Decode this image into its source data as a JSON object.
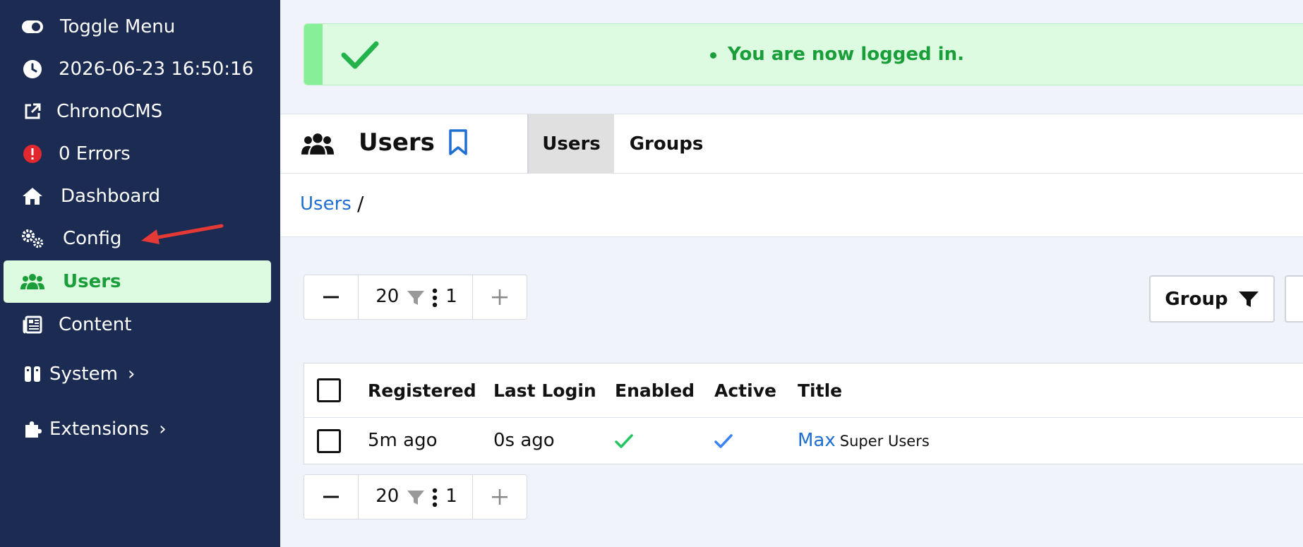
{
  "sidebar": {
    "items": [
      {
        "label": "Toggle Menu",
        "icon": "toggle-icon"
      },
      {
        "label": "2026-06-23 16:50:16",
        "icon": "clock-icon"
      },
      {
        "label": "ChronoCMS",
        "icon": "external-link-icon"
      },
      {
        "label": "0 Errors",
        "icon": "error-icon"
      },
      {
        "label": "Dashboard",
        "icon": "home-icon"
      },
      {
        "label": "Config",
        "icon": "gears-icon"
      },
      {
        "label": "Users",
        "icon": "users-icon",
        "active": true
      },
      {
        "label": "Content",
        "icon": "newspaper-icon"
      },
      {
        "label": "System",
        "icon": "system-icon",
        "chevron": "›"
      },
      {
        "label": "Extensions",
        "icon": "puzzle-icon",
        "chevron": "›"
      }
    ]
  },
  "alert": {
    "message": "You are now logged in.",
    "color": "#1a9e3a"
  },
  "header": {
    "title": "Users",
    "tabs": [
      {
        "label": "Users",
        "active": true
      },
      {
        "label": "Groups",
        "active": false
      }
    ]
  },
  "breadcrumb": {
    "link": "Users",
    "separator": "/"
  },
  "pager": {
    "minus": "−",
    "plus": "+",
    "per_page": "20",
    "page": "1"
  },
  "group_button": {
    "label": "Group"
  },
  "table": {
    "columns": [
      "Registered",
      "Last Login",
      "Enabled",
      "Active",
      "Title"
    ],
    "rows": [
      {
        "registered": "5m ago",
        "last_login": "0s ago",
        "enabled": true,
        "active": true,
        "title": "Max",
        "group": "Super Users"
      }
    ]
  },
  "colors": {
    "sidebar": "#1b2b52",
    "accent_green": "#1a9e3a",
    "link_blue": "#1e6fd0"
  }
}
